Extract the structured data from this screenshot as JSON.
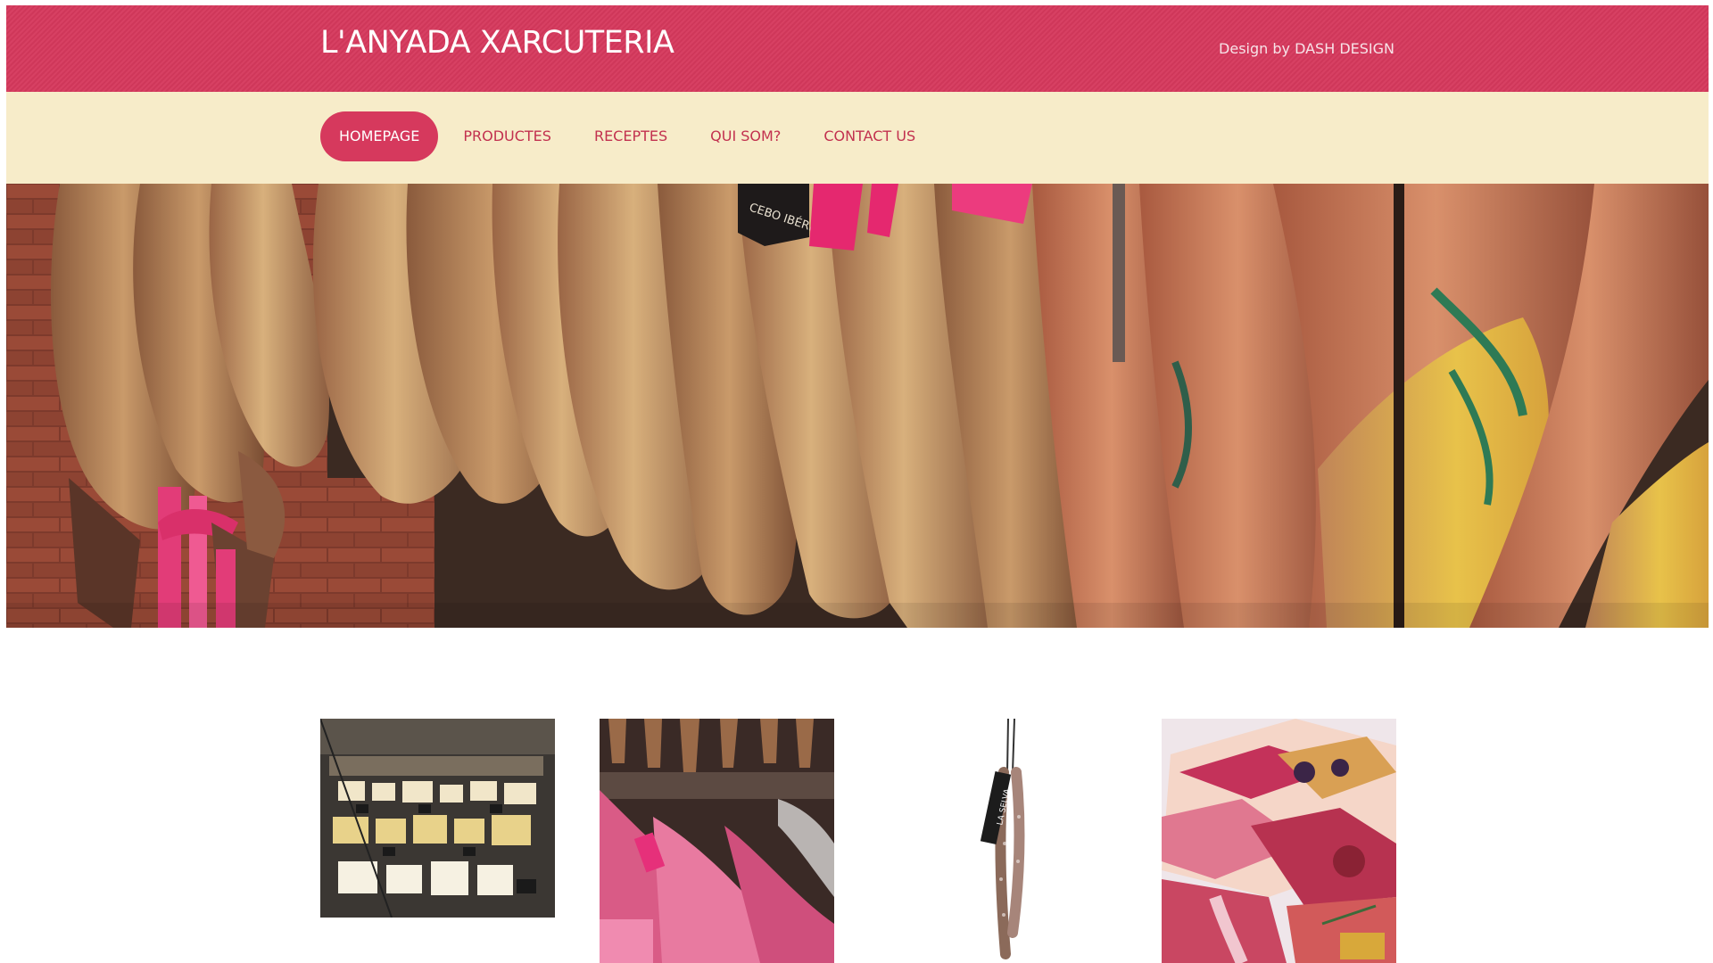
{
  "header": {
    "title": "L'ANYADA XARCUTERIA",
    "credit": "Design by DASH DESIGN"
  },
  "nav": {
    "items": [
      {
        "label": "HOMEPAGE",
        "active": true
      },
      {
        "label": "PRODUCTES",
        "active": false
      },
      {
        "label": "RECEPTES",
        "active": false
      },
      {
        "label": "QUI SOM?",
        "active": false
      },
      {
        "label": "CONTACT US",
        "active": false
      }
    ]
  },
  "hero": {
    "image": "hanging-iberian-hams-photo",
    "label_text": "CEBO IBÉRICO"
  },
  "gallery": {
    "items": [
      {
        "image": "cheese-counter-photo"
      },
      {
        "image": "ham-shop-photo"
      },
      {
        "image": "fuet-sausage-photo",
        "label_text": "LA SELVA"
      },
      {
        "image": "charcuterie-platters-photo"
      }
    ]
  },
  "colors": {
    "brand": "#d6395d",
    "nav_bg": "#f7ecc9",
    "nav_text": "#c2314f"
  }
}
